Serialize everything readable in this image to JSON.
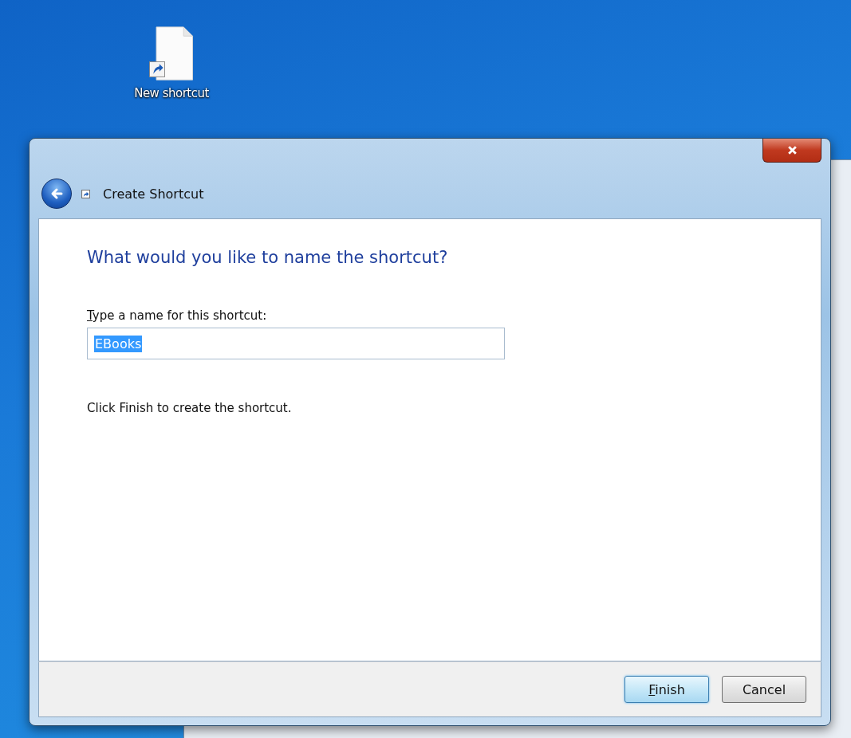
{
  "desktop": {
    "icons": [
      {
        "label": "New shortcut"
      }
    ]
  },
  "dialog": {
    "title": "Create Shortcut",
    "heading": "What would you like to name the shortcut?",
    "name_field": {
      "label": "Type a name for this shortcut:",
      "value": "EBooks",
      "selected": true
    },
    "instruction": "Click Finish to create the shortcut.",
    "buttons": [
      {
        "label": "Finish",
        "kind": "default"
      },
      {
        "label": "Cancel",
        "kind": "normal"
      }
    ]
  }
}
